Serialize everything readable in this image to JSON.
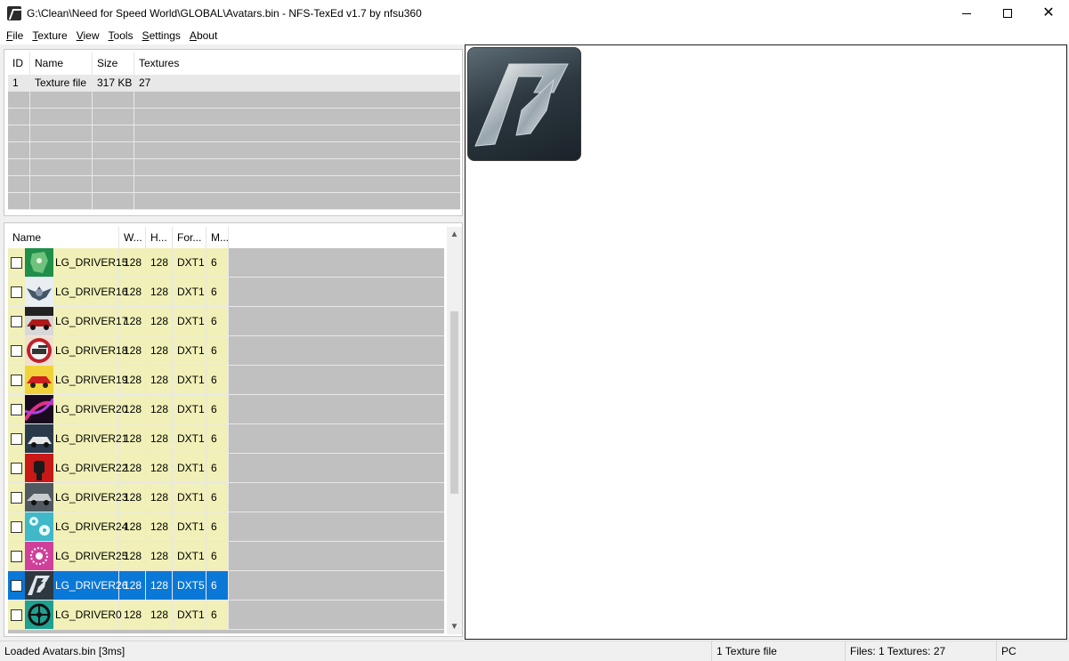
{
  "window": {
    "title": "G:\\Clean\\Need for Speed World\\GLOBAL\\Avatars.bin - NFS-TexEd v1.7 by nfsu360"
  },
  "menu": [
    {
      "acc": "F",
      "rest": "ile"
    },
    {
      "acc": "T",
      "rest": "exture"
    },
    {
      "acc": "V",
      "rest": "iew"
    },
    {
      "acc": "T",
      "rest": "ools"
    },
    {
      "acc": "S",
      "rest": "ettings"
    },
    {
      "acc": "A",
      "rest": "bout"
    }
  ],
  "files": {
    "columns": [
      "ID",
      "Name",
      "Size",
      "Textures"
    ],
    "rows": [
      {
        "id": "1",
        "name": "Texture file",
        "size": "317 KB",
        "textures": "27"
      }
    ]
  },
  "textures": {
    "columns": [
      "Name",
      "W...",
      "H...",
      "For...",
      "M..."
    ],
    "rows": [
      {
        "name": "LG_DRIVER15",
        "w": "128",
        "h": "128",
        "fmt": "DXT1",
        "m": "6",
        "thumb": "green-map",
        "selected": false
      },
      {
        "name": "LG_DRIVER16",
        "w": "128",
        "h": "128",
        "fmt": "DXT1",
        "m": "6",
        "thumb": "winged-emblem",
        "selected": false
      },
      {
        "name": "LG_DRIVER17",
        "w": "128",
        "h": "128",
        "fmt": "DXT1",
        "m": "6",
        "thumb": "red-car",
        "selected": false
      },
      {
        "name": "LG_DRIVER18",
        "w": "128",
        "h": "128",
        "fmt": "DXT1",
        "m": "6",
        "thumb": "tank-badge",
        "selected": false
      },
      {
        "name": "LG_DRIVER19",
        "w": "128",
        "h": "128",
        "fmt": "DXT1",
        "m": "6",
        "thumb": "yellow-car",
        "selected": false
      },
      {
        "name": "LG_DRIVER20",
        "w": "128",
        "h": "128",
        "fmt": "DXT1",
        "m": "6",
        "thumb": "neon-swirl",
        "selected": false
      },
      {
        "name": "LG_DRIVER21",
        "w": "128",
        "h": "128",
        "fmt": "DXT1",
        "m": "6",
        "thumb": "white-car",
        "selected": false
      },
      {
        "name": "LG_DRIVER22",
        "w": "128",
        "h": "128",
        "fmt": "DXT1",
        "m": "6",
        "thumb": "red-fist",
        "selected": false
      },
      {
        "name": "LG_DRIVER23",
        "w": "128",
        "h": "128",
        "fmt": "DXT1",
        "m": "6",
        "thumb": "silver-car",
        "selected": false
      },
      {
        "name": "LG_DRIVER24",
        "w": "128",
        "h": "128",
        "fmt": "DXT1",
        "m": "6",
        "thumb": "teal-flowers",
        "selected": false
      },
      {
        "name": "LG_DRIVER25",
        "w": "128",
        "h": "128",
        "fmt": "DXT1",
        "m": "6",
        "thumb": "pink-burst",
        "selected": false
      },
      {
        "name": "LG_DRIVER26",
        "w": "128",
        "h": "128",
        "fmt": "DXT5",
        "m": "6",
        "thumb": "nfs-logo",
        "selected": true
      },
      {
        "name": "LG_DRIVER0",
        "w": "128",
        "h": "128",
        "fmt": "DXT1",
        "m": "6",
        "thumb": "wheel",
        "selected": false
      }
    ]
  },
  "preview": {
    "image": "nfs-logo"
  },
  "status": {
    "message": "Loaded Avatars.bin [3ms]",
    "filetype": "1 Texture file",
    "counts": "Files: 1 Textures: 27",
    "platform": "PC"
  },
  "colors": {
    "selection": "#0a78d7",
    "cell_highlight": "#f0f0b8",
    "empty_row": "#c0c0c0"
  }
}
